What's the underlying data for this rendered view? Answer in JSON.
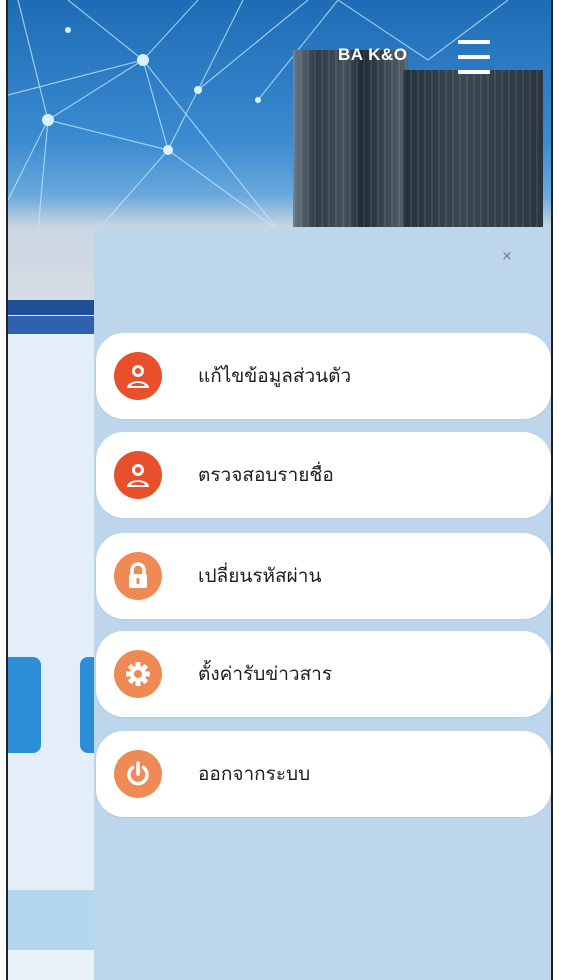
{
  "header": {
    "brand": "BA K&O"
  },
  "drawer": {
    "close_label": "×",
    "items": [
      {
        "label": "แก้ไขข้อมูลส่วนตัว",
        "icon": "user-icon",
        "color": "#e8502b"
      },
      {
        "label": "ตรวจสอบรายชื่อ",
        "icon": "user-icon",
        "color": "#e8502b"
      },
      {
        "label": "เปลี่ยนรหัสผ่าน",
        "icon": "lock-icon",
        "color": "#f08a55"
      },
      {
        "label": "ตั้งค่ารับข่าวสาร",
        "icon": "gear-icon",
        "color": "#f08a55"
      },
      {
        "label": "ออกจากระบบ",
        "icon": "power-icon",
        "color": "#f08a55"
      }
    ]
  },
  "colors": {
    "drawer_bg": "#bdd6ec",
    "accent_blue": "#2d8ed8"
  }
}
